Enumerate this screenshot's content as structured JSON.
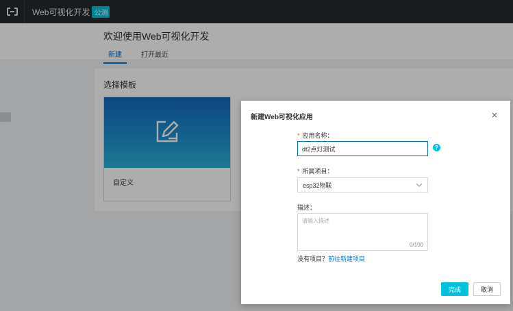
{
  "topbar": {
    "logo_icon": "aliyun-logo-icon",
    "app_title": "Web可视化开发",
    "badge": "公测"
  },
  "header": {
    "title": "欢迎使用Web可视化开发",
    "tabs": [
      {
        "label": "新建",
        "active": true
      },
      {
        "label": "打开最近",
        "active": false
      }
    ]
  },
  "main": {
    "section_title": "选择模板",
    "templates": [
      {
        "label": "自定义",
        "icon": "edit-pen-icon"
      }
    ]
  },
  "dialog": {
    "title": "新建Web可视化应用",
    "app_name_label": "应用名称：",
    "app_name_value": "dt2点灯测试",
    "project_label": "所属项目：",
    "project_value": "esp32物联",
    "desc_label": "描述：",
    "desc_placeholder": "请输入描述",
    "desc_counter": "0/100",
    "hint_text": "没有项目？",
    "hint_link": "前往新建项目",
    "confirm_label": "完成",
    "cancel_label": "取消",
    "required_mark": "*"
  },
  "colors": {
    "accent": "#00c1de",
    "link": "#0070cc",
    "topbar_bg": "#262a2f",
    "required": "#e5453a"
  }
}
